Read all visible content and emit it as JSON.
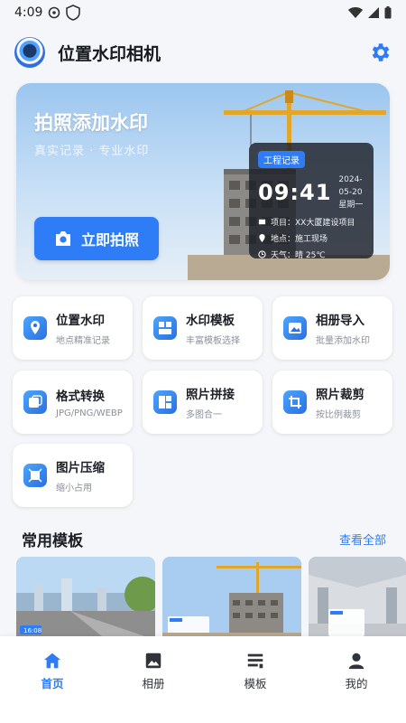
{
  "status_bar": {
    "time": "4:09"
  },
  "header": {
    "title": "位置水印相机"
  },
  "hero": {
    "title": "拍照添加水印",
    "subtitle": "真实记录 · 专业水印",
    "button_label": "立即拍照",
    "watermark": {
      "tag": "工程记录",
      "time": "09:41",
      "date": "2024-05-20",
      "weekday": "星期一",
      "project": "项目：XX大厦建设项目",
      "location": "地点：施工现场",
      "weather": "天气：晴 25℃"
    }
  },
  "tools": [
    {
      "title": "位置水印",
      "subtitle": "地点精准记录",
      "icon": "location-icon"
    },
    {
      "title": "水印模板",
      "subtitle": "丰富模板选择",
      "icon": "template-icon"
    },
    {
      "title": "相册导入",
      "subtitle": "批量添加水印",
      "icon": "album-import-icon"
    },
    {
      "title": "格式转换",
      "subtitle": "JPG/PNG/WEBP",
      "icon": "format-convert-icon"
    },
    {
      "title": "照片拼接",
      "subtitle": "多图合一",
      "icon": "collage-icon"
    },
    {
      "title": "照片裁剪",
      "subtitle": "按比例裁剪",
      "icon": "crop-icon"
    },
    {
      "title": "图片压缩",
      "subtitle": "缩小占用",
      "icon": "compress-icon"
    }
  ],
  "templates_section": {
    "title": "常用模板",
    "view_all": "查看全部",
    "thumb_1_time": "16:08"
  },
  "bottom_nav": [
    {
      "label": "首页",
      "icon": "home-icon",
      "active": true
    },
    {
      "label": "相册",
      "icon": "album-icon",
      "active": false
    },
    {
      "label": "模板",
      "icon": "template-list-icon",
      "active": false
    },
    {
      "label": "我的",
      "icon": "profile-icon",
      "active": false
    }
  ],
  "colors": {
    "accent": "#2f7df6",
    "background": "#f4f6f9"
  }
}
